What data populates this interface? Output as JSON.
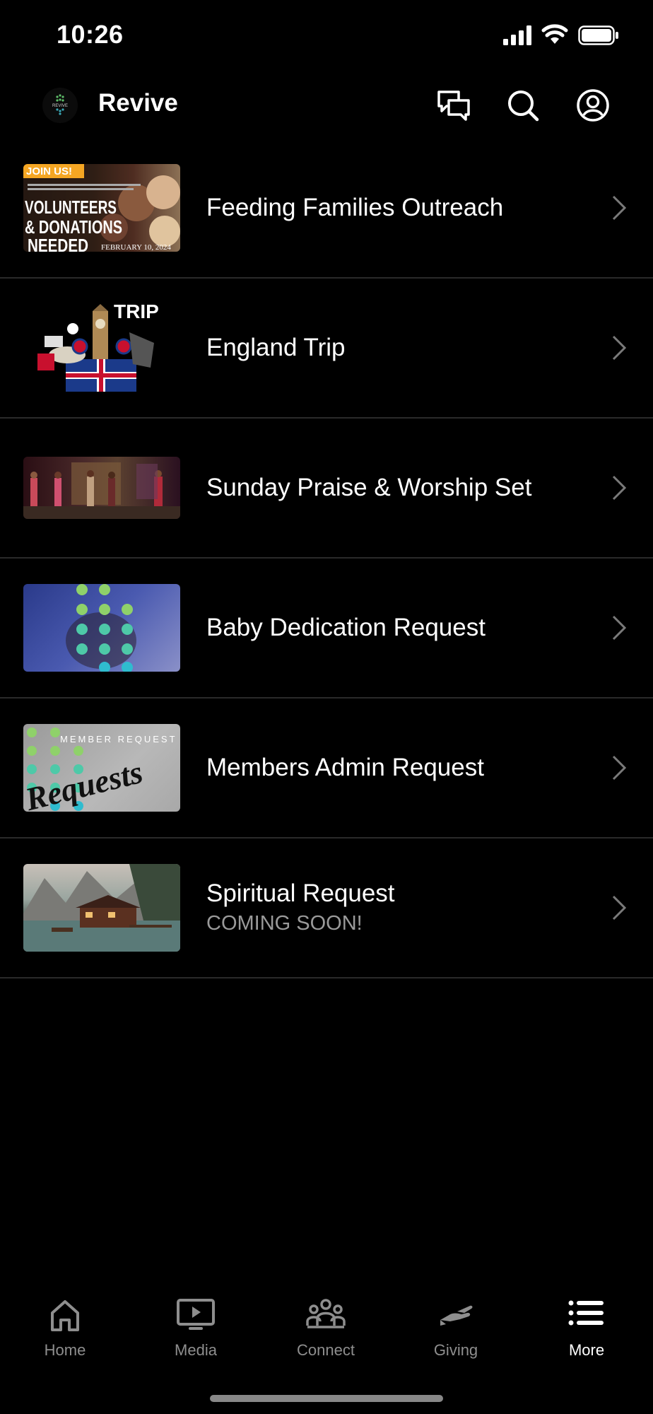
{
  "status_bar": {
    "time": "10:26"
  },
  "header": {
    "title": "Revive",
    "logo_text": "REVIVE"
  },
  "items": [
    {
      "title": "Feeding Families Outreach",
      "subtitle": "",
      "thumb": {
        "badge": "JOIN US!",
        "line1": "VOLUNTEERS",
        "line2": "& DONATIONS",
        "line3": "NEEDED",
        "date": "FEBRUARY 10, 2024"
      }
    },
    {
      "title": "England Trip",
      "subtitle": "",
      "thumb": {
        "word": "TRIP"
      }
    },
    {
      "title": "Sunday Praise & Worship Set",
      "subtitle": "",
      "thumb": {}
    },
    {
      "title": "Baby Dedication Request",
      "subtitle": "",
      "thumb": {}
    },
    {
      "title": "Members Admin Request",
      "subtitle": "",
      "thumb": {
        "caption": "MEMBER REQUEST",
        "script": "Requests"
      }
    },
    {
      "title": "Spiritual Request",
      "subtitle": "COMING SOON!",
      "thumb": {}
    }
  ],
  "tabs": [
    {
      "label": "Home",
      "icon": "home-icon"
    },
    {
      "label": "Media",
      "icon": "media-icon"
    },
    {
      "label": "Connect",
      "icon": "connect-icon"
    },
    {
      "label": "Giving",
      "icon": "giving-icon"
    },
    {
      "label": "More",
      "icon": "more-icon"
    }
  ],
  "active_tab": "More",
  "colors": {
    "background": "#000000",
    "divider": "#2a2a2a",
    "inactive_tab": "#8e8e8e",
    "subtitle": "#9a9a9a"
  }
}
